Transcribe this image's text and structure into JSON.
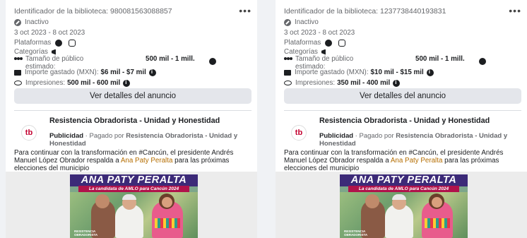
{
  "cards": [
    {
      "library_id": "Identificador de la biblioteca: 980081563088857",
      "menu_label": "•••",
      "status": "Inactivo",
      "dates": "3 oct 2023 - 8 oct 2023",
      "platforms_label": "Plataformas",
      "categories_label": "Categorías",
      "audience_label": "Tamaño de público estimado:",
      "audience_value": "500 mil - 1 mill.",
      "spend_label": "Importe gastado (MXN):",
      "spend_value": "$6 mil - $7 mil",
      "impressions_label": "Impresiones:",
      "impressions_value": "500 mil - 600 mil",
      "details_button": "Ver detalles del anuncio",
      "page_initials": "tb",
      "page_name": "Resistencia Obradorista - Unidad y Honestidad",
      "sponsored": "Publicidad",
      "paid_by_prefix": " · Pagado por ",
      "paid_by": "Resistencia Obradorista - Unidad y Honestidad",
      "body_prefix": "Para continuar con la transformación en #Cancún, el presidente Andrés Manuel López Obrador respalda a ",
      "body_link": "Ana Paty Peralta",
      "body_suffix": " para las próximas elecciones del municipio",
      "creative_title": "ANA PATY PERALTA",
      "creative_subtitle": "La candidata de AMLO para Cancún 2024",
      "creative_logo": "RESISTENCIA OBRADORISTA"
    },
    {
      "library_id": "Identificador de la biblioteca: 1237738440193831",
      "menu_label": "•••",
      "status": "Inactivo",
      "dates": "3 oct 2023 - 8 oct 2023",
      "platforms_label": "Plataformas",
      "categories_label": "Categorías",
      "audience_label": "Tamaño de público estimado:",
      "audience_value": "500 mil - 1 mill.",
      "spend_label": "Importe gastado (MXN):",
      "spend_value": "$10 mil - $15 mil",
      "impressions_label": "Impresiones:",
      "impressions_value": "350 mil - 400 mil",
      "details_button": "Ver detalles del anuncio",
      "page_initials": "tb",
      "page_name": "Resistencia Obradorista - Unidad y Honestidad",
      "sponsored": "Publicidad",
      "paid_by_prefix": " · Pagado por ",
      "paid_by": "Resistencia Obradorista - Unidad y Honestidad",
      "body_prefix": "Para continuar con la transformación en #Cancún, el presidente Andrés Manuel López Obrador respalda a ",
      "body_link": "Ana Paty Peralta",
      "body_suffix": " para las próximas elecciones del municipio",
      "creative_title": "ANA PATY PERALTA",
      "creative_subtitle": "La candidata de AMLO para Cancún 2024",
      "creative_logo": "RESISTENCIA OBRADORISTA"
    }
  ],
  "colors": {
    "title_band": "#3c2a78",
    "subtitle_band": "#b0124b",
    "link": "#b46d00"
  },
  "icons": [
    "status-icon",
    "facebook-icon",
    "instagram-icon",
    "megaphone-icon",
    "audience-icon",
    "info-icon",
    "money-icon",
    "eye-icon",
    "more-options-icon"
  ]
}
